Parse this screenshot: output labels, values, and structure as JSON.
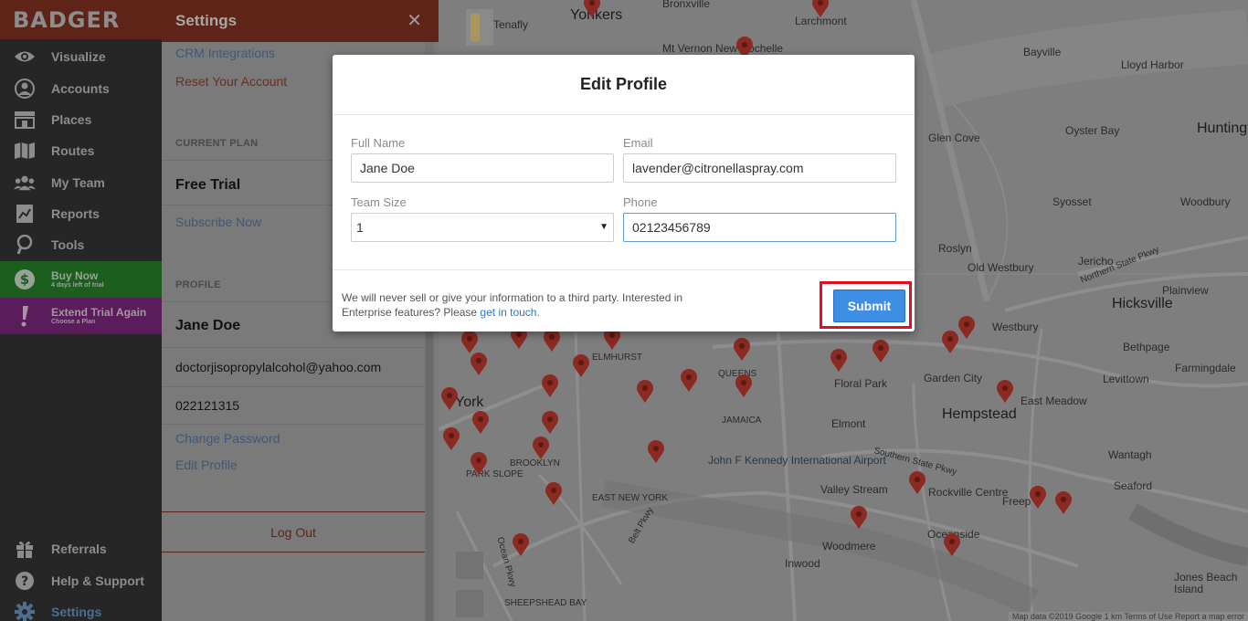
{
  "app": {
    "logo": "BADGER"
  },
  "nav": {
    "items": [
      {
        "label": "Visualize",
        "icon": "eye-icon"
      },
      {
        "label": "Accounts",
        "icon": "user-circle-icon"
      },
      {
        "label": "Places",
        "icon": "store-icon"
      },
      {
        "label": "Routes",
        "icon": "map-icon"
      },
      {
        "label": "My Team",
        "icon": "team-icon"
      },
      {
        "label": "Reports",
        "icon": "reports-icon"
      },
      {
        "label": "Tools",
        "icon": "tools-icon"
      }
    ],
    "buy_now": {
      "label": "Buy Now",
      "sub": "4 days left of trial",
      "color": "#1b5e1e"
    },
    "extend_trial": {
      "label": "Extend Trial Again",
      "sub": "Choose a Plan",
      "color": "#5a1c5a"
    },
    "bottom": [
      {
        "label": "Referrals",
        "icon": "gift-icon"
      },
      {
        "label": "Help & Support",
        "icon": "help-icon"
      },
      {
        "label": "Settings",
        "icon": "gear-icon"
      }
    ]
  },
  "settings": {
    "title": "Settings",
    "crm_link": "CRM Integrations",
    "reset_link": "Reset Your Account",
    "current_plan_heading": "CURRENT PLAN",
    "plan_name": "Free Trial",
    "subscribe_link": "Subscribe Now",
    "profile_heading": "PROFILE",
    "profile_name": "Jane Doe",
    "profile_email": "doctorjisopropylalcohol@yahoo.com",
    "profile_phone": "022121315",
    "change_password_link": "Change Password",
    "edit_profile_link": "Edit Profile",
    "logout": "Log Out"
  },
  "map": {
    "places": [
      {
        "name": "Yonkers",
        "cls": "big"
      },
      {
        "name": "Tenafly",
        "cls": ""
      },
      {
        "name": "Bronxville",
        "cls": ""
      },
      {
        "name": "Larchmont",
        "cls": ""
      },
      {
        "name": "Mt Vernon New Rochelle",
        "cls": ""
      },
      {
        "name": "Bayville",
        "cls": ""
      },
      {
        "name": "Lloyd Harbor",
        "cls": ""
      },
      {
        "name": "Huntingt",
        "cls": ""
      },
      {
        "name": "Oyster Bay",
        "cls": ""
      },
      {
        "name": "Glen Cove",
        "cls": ""
      },
      {
        "name": "Syosset",
        "cls": ""
      },
      {
        "name": "Woodbury",
        "cls": ""
      },
      {
        "name": "Roslyn",
        "cls": ""
      },
      {
        "name": "Jericho",
        "cls": ""
      },
      {
        "name": "Old Westbury",
        "cls": ""
      },
      {
        "name": "Hicksville",
        "cls": "big"
      },
      {
        "name": "Plainview",
        "cls": ""
      },
      {
        "name": "Westbury",
        "cls": ""
      },
      {
        "name": "Bethpage",
        "cls": ""
      },
      {
        "name": "Farmingdale",
        "cls": ""
      },
      {
        "name": "Levittown",
        "cls": ""
      },
      {
        "name": "Garden City",
        "cls": ""
      },
      {
        "name": "Floral Park",
        "cls": ""
      },
      {
        "name": "East Meadow",
        "cls": ""
      },
      {
        "name": "Hempstead",
        "cls": "big"
      },
      {
        "name": "Elmont",
        "cls": ""
      },
      {
        "name": "Wantagh",
        "cls": ""
      },
      {
        "name": "Valley Stream",
        "cls": ""
      },
      {
        "name": "Rockville Centre",
        "cls": ""
      },
      {
        "name": "Seaford",
        "cls": ""
      },
      {
        "name": "Freep",
        "cls": ""
      },
      {
        "name": "Woodmere",
        "cls": ""
      },
      {
        "name": "Oceanside",
        "cls": ""
      },
      {
        "name": "Inwood",
        "cls": ""
      },
      {
        "name": "Jones Beach Island",
        "cls": ""
      },
      {
        "name": "York",
        "cls": "big"
      },
      {
        "name": "ELMHURST",
        "cls": ""
      },
      {
        "name": "QUEENS",
        "cls": ""
      },
      {
        "name": "JAMAICA",
        "cls": ""
      },
      {
        "name": "BROOKLYN",
        "cls": ""
      },
      {
        "name": "PARK SLOPE",
        "cls": ""
      },
      {
        "name": "EAST NEW YORK",
        "cls": ""
      },
      {
        "name": "SHEEPSHEAD BAY",
        "cls": ""
      },
      {
        "name": "John F Kennedy International Airport",
        "cls": "blue"
      },
      {
        "name": "Ocean Pkwy",
        "cls": ""
      },
      {
        "name": "Belt Pkwy",
        "cls": ""
      },
      {
        "name": "Southern State Pkwy",
        "cls": ""
      },
      {
        "name": "Northern State Pkwy",
        "cls": ""
      },
      {
        "name": "Map data ©2019 Google   1 km   Terms of Use   Report a map error",
        "cls": ""
      }
    ]
  },
  "modal": {
    "title": "Edit Profile",
    "full_name_label": "Full Name",
    "full_name_value": "Jane Doe",
    "email_label": "Email",
    "email_value": "lavender@citronellaspray.com",
    "team_size_label": "Team Size",
    "team_size_value": "1",
    "phone_label": "Phone",
    "phone_value": "02123456789",
    "disclaimer_text": "We will never sell or give your information to a third party. Interested in Enterprise features? Please ",
    "disclaimer_link": "get in touch.",
    "submit_label": "Submit",
    "accent_color": "#3f8ee6",
    "highlight_color": "#e0101e"
  }
}
